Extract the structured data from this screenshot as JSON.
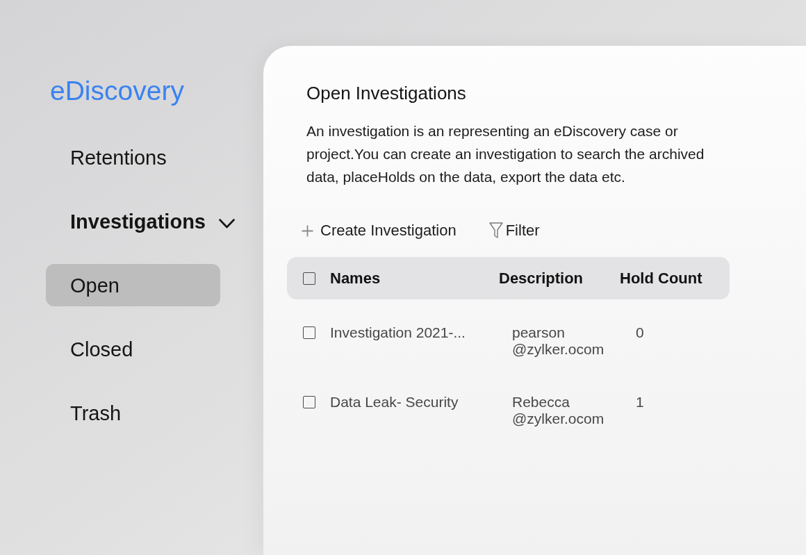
{
  "sidebar": {
    "logo": "eDiscovery",
    "items": [
      {
        "label": "Retentions",
        "selected": false
      },
      {
        "label": "Investigations",
        "selected": false,
        "expanded": true,
        "children": [
          {
            "label": "Open",
            "selected": true
          },
          {
            "label": "Closed",
            "selected": false
          },
          {
            "label": "Trash",
            "selected": false
          }
        ]
      }
    ]
  },
  "main": {
    "title": "Open Investigations",
    "description": "An investigation is an representing an eDiscovery case or project.You can create an investigation to search the archived data, placeHolds on the data, export the data etc.",
    "toolbar": [
      {
        "kind": "create",
        "label": "Create Investigation"
      },
      {
        "kind": "filter",
        "label": "Filter"
      }
    ],
    "table": {
      "select_all_checked": false,
      "columns": [
        "Names",
        "Description",
        "Hold Count"
      ],
      "rows": [
        {
          "checked": false,
          "name": "Investigation 2021-...",
          "description": "pearson @zylker.ocom",
          "hold_count": "0"
        },
        {
          "checked": false,
          "name": "Data Leak- Security",
          "description": "Rebecca @zylker.ocom",
          "hold_count": "1"
        }
      ]
    }
  }
}
